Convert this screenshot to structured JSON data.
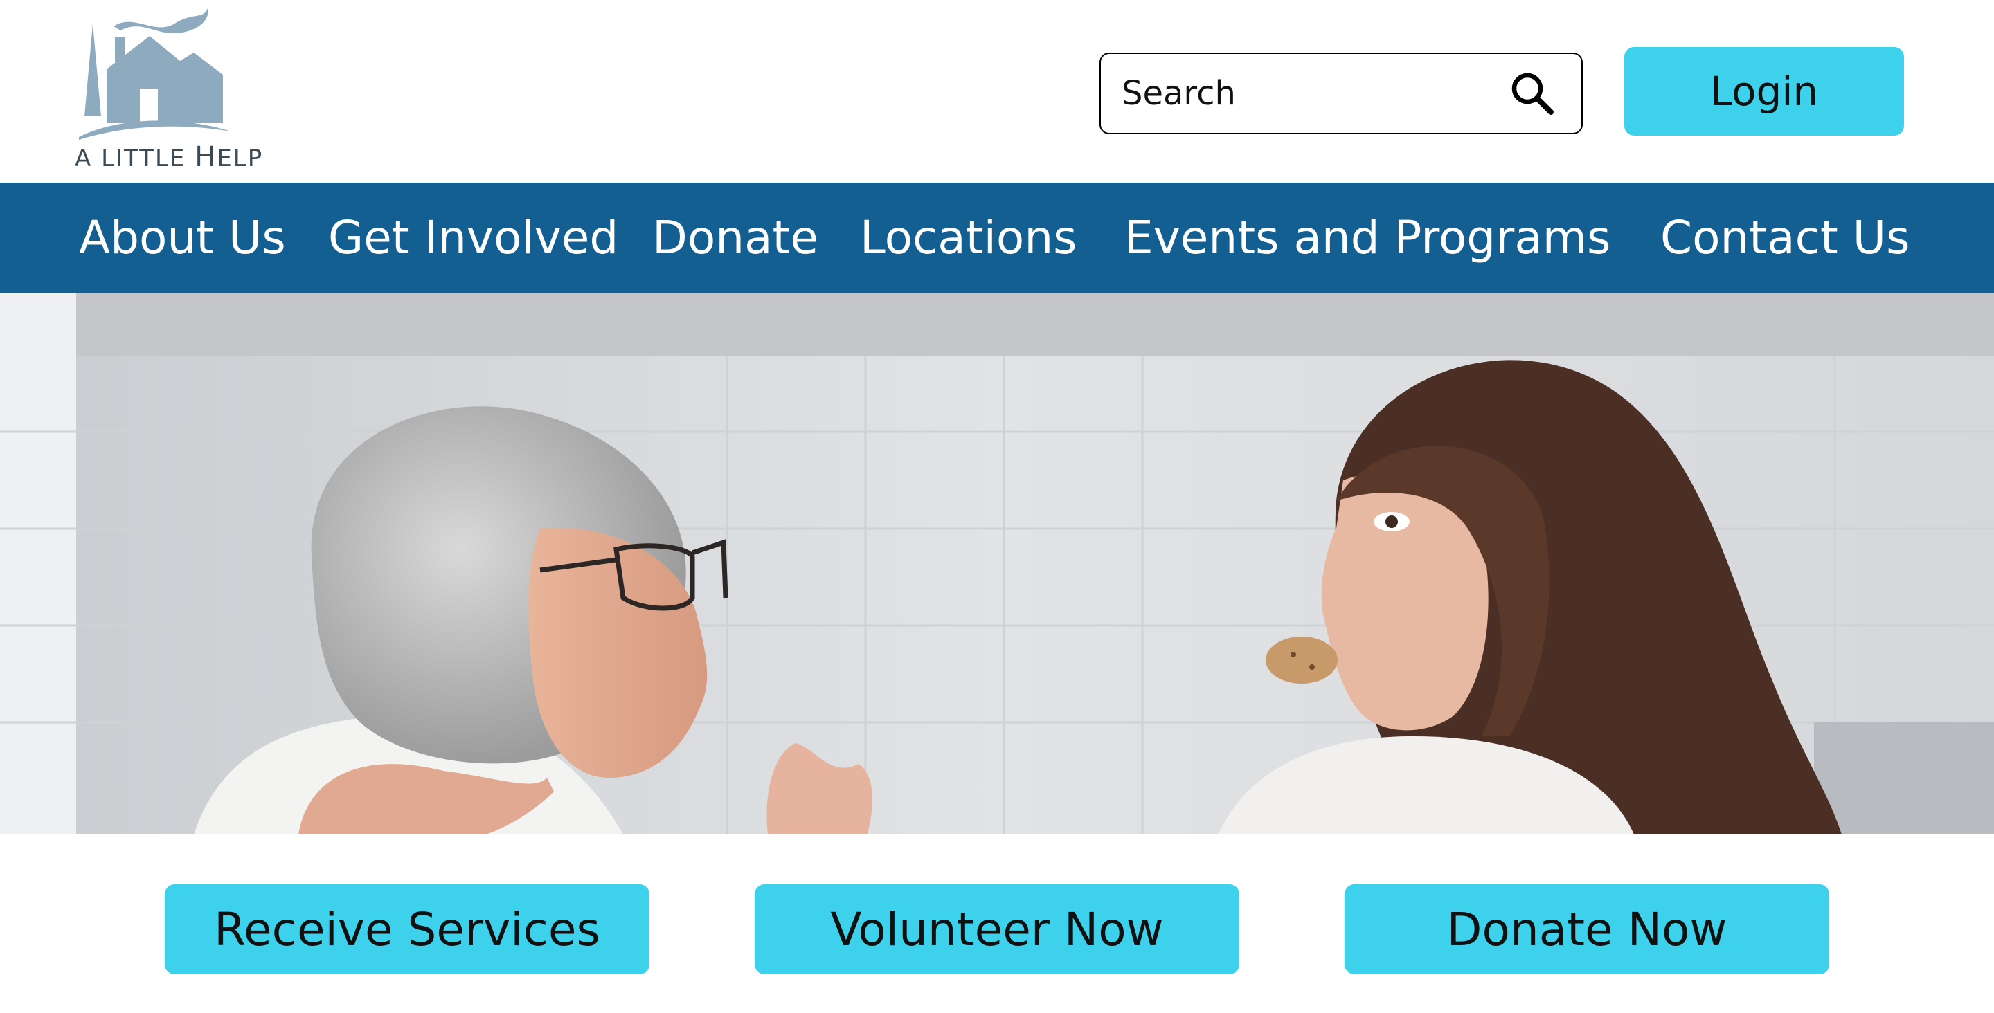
{
  "brand": {
    "name": "A Little Help",
    "name_first": "A L",
    "name_rest_1": "ITTLE ",
    "name_h": "H",
    "name_rest_2": "ELP",
    "logo_color": "#8eaabf"
  },
  "header": {
    "search_placeholder": "Search",
    "search_icon": "magnifier-icon",
    "login_label": "Login"
  },
  "nav": {
    "items": [
      {
        "label": "About Us"
      },
      {
        "label": "Get Involved"
      },
      {
        "label": "Donate"
      },
      {
        "label": "Locations"
      },
      {
        "label": "Events and Programs"
      },
      {
        "label": "Contact Us"
      }
    ]
  },
  "cta": {
    "receive": "Receive Services",
    "volunteer": "Volunteer Now",
    "donate": "Donate Now"
  },
  "colors": {
    "nav_bg": "#135f92",
    "accent": "#3dd1ec",
    "text": "#111111"
  }
}
